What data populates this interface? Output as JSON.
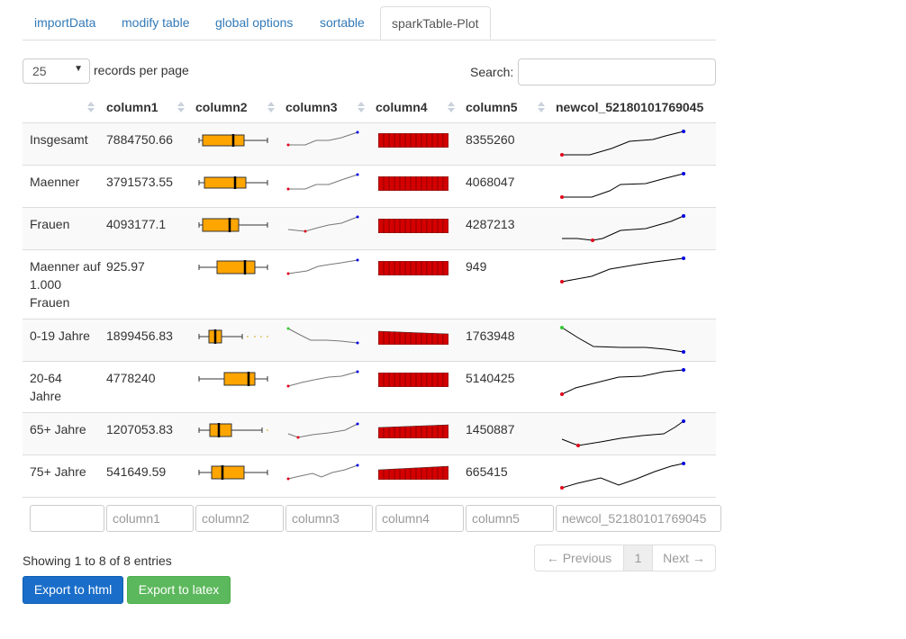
{
  "tabs": [
    {
      "label": "importData"
    },
    {
      "label": "modify table"
    },
    {
      "label": "global options"
    },
    {
      "label": "sortable"
    },
    {
      "label": "sparkTable-Plot",
      "active": true
    }
  ],
  "length_menu": {
    "value": "25",
    "label": "records per page"
  },
  "search": {
    "label": "Search:",
    "value": ""
  },
  "table": {
    "headers": [
      "",
      "column1",
      "column2",
      "column3",
      "column4",
      "column5",
      "newcol_52180101769045"
    ],
    "rows": [
      {
        "label": "Insgesamt",
        "column1": "7884750.66",
        "column5": "8355260"
      },
      {
        "label": "Maenner",
        "column1": "3791573.55",
        "column5": "4068047"
      },
      {
        "label": "Frauen",
        "column1": "4093177.1",
        "column5": "4287213"
      },
      {
        "label": "Maenner auf 1.000 Frauen",
        "column1": "925.97",
        "column5": "949"
      },
      {
        "label": "0-19 Jahre",
        "column1": "1899456.83",
        "column5": "1763948"
      },
      {
        "label": "20-64 Jahre",
        "column1": "4778240",
        "column5": "5140425"
      },
      {
        "label": "65+ Jahre",
        "column1": "1207053.83",
        "column5": "1450887"
      },
      {
        "label": "75+ Jahre",
        "column1": "541649.59",
        "column5": "665415"
      }
    ],
    "filters": [
      "",
      "column1",
      "column2",
      "column3",
      "column4",
      "column5",
      "newcol_52180101769045"
    ]
  },
  "info": "Showing 1 to 8 of 8 entries",
  "pagination": {
    "previous": "← Previous",
    "page": "1",
    "next": "Next →"
  },
  "buttons": {
    "export_html": "Export to html",
    "export_latex": "Export to latex"
  },
  "colors": {
    "box_fill": "#ffa500",
    "bar_fill": "#d40000",
    "min_point": "#e0001a",
    "max_point": "#0000e0",
    "start_point": "#33cc33",
    "link": "#337ab7"
  }
}
